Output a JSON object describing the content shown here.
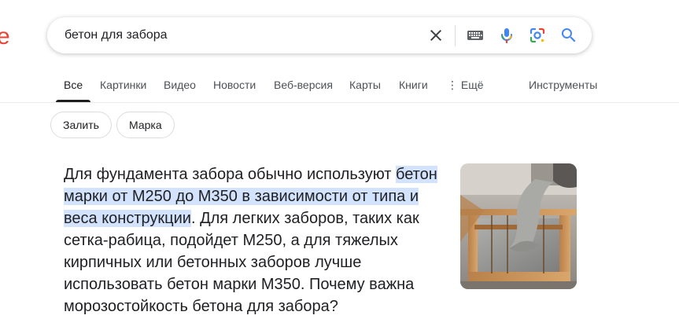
{
  "logo": {
    "fragment": "e"
  },
  "search": {
    "query": "бетон для забора",
    "icons": [
      "close-icon",
      "keyboard-icon",
      "mic-icon",
      "lens-icon",
      "search-icon"
    ]
  },
  "tabs": [
    {
      "label": "Все",
      "active": true
    },
    {
      "label": "Картинки"
    },
    {
      "label": "Видео"
    },
    {
      "label": "Новости"
    },
    {
      "label": "Веб-версия"
    },
    {
      "label": "Карты"
    },
    {
      "label": "Книги"
    },
    {
      "label": "⋮ Ещё"
    }
  ],
  "tools_label": "Инструменты",
  "chips": [
    "Залить",
    "Марка"
  ],
  "answer": {
    "prefix": "Для фундамента забора обычно используют ",
    "highlight": "бетон марки от М250 до М350 в зависимости от типа и веса конструкции",
    "suffix": ". Для легких заборов, таких как сетка-рабица, подойдет М250, а для тяжелых кирпичных или бетонных заборов лучше использовать бетон марки М350. Почему важна морозостойкость бетона для забора?"
  },
  "colors": {
    "accent_blue": "#4285f4",
    "brand_red": "#ea4335",
    "highlight": "#d3e3fd"
  }
}
